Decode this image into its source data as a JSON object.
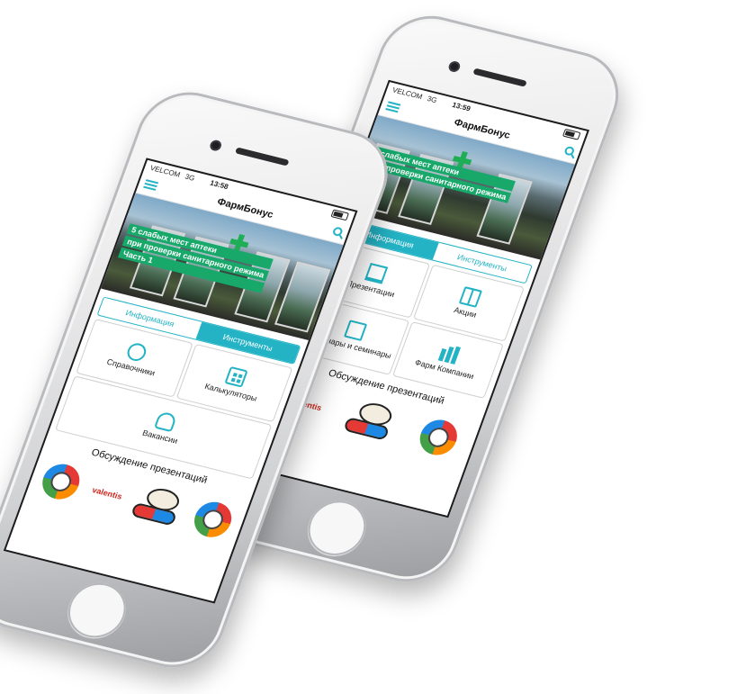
{
  "colors": {
    "accent": "#23b3c5",
    "banner_caption_bg": "#17a86a"
  },
  "back_phone": {
    "status": {
      "carrier": "VELCOM",
      "network": "3G",
      "time": "13:59"
    },
    "app_title": "ФармБонус",
    "banner_lines": [
      "5 слабых мест аптеки",
      "при проверки санитарного режима"
    ],
    "tabs": [
      {
        "label": "Информация",
        "active": true
      },
      {
        "label": "Инструменты",
        "active": false
      }
    ],
    "cards": [
      {
        "label": "Презентации",
        "icon": "easel-icon"
      },
      {
        "label": "Акции",
        "icon": "gift-icon"
      },
      {
        "label": "Вебинары и семинары",
        "icon": "webinar-icon"
      },
      {
        "label": "Фарм Компании",
        "icon": "company-icon"
      }
    ],
    "section_title": "Обсуждение презентаций",
    "logos": {
      "valentis": "valentis",
      "rb_left": "РВ",
      "rb_right": "РВ"
    }
  },
  "front_phone": {
    "status": {
      "carrier": "VELCOM",
      "network": "3G",
      "time": "13:58"
    },
    "app_title": "ФармБонус",
    "banner_lines": [
      "5 слабых мест аптеки",
      "при проверки санитарного режима",
      "Часть 1"
    ],
    "tabs": [
      {
        "label": "Информация",
        "active": false
      },
      {
        "label": "Инструменты",
        "active": true
      }
    ],
    "cards": [
      {
        "label": "Справочники",
        "icon": "pill-info-icon"
      },
      {
        "label": "Калькуляторы",
        "icon": "calculator-icon"
      },
      {
        "label": "Вакансии",
        "icon": "doctor-icon"
      }
    ],
    "section_title": "Обсуждение презентаций",
    "logos": {
      "valentis": "valentis",
      "rb_left": "РВ",
      "rb_right": "РВ"
    }
  }
}
